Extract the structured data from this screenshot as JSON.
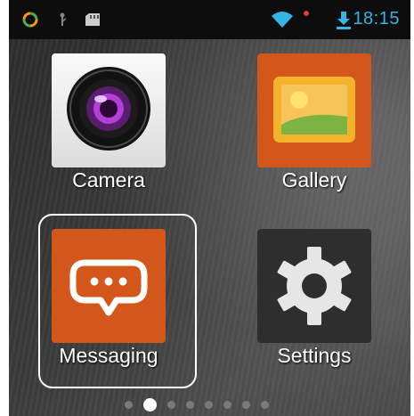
{
  "status_bar": {
    "time": "18:15",
    "icons": [
      "sync-icon",
      "usb-icon",
      "sd-card-icon",
      "wifi-icon",
      "alert-dot-icon",
      "download-icon"
    ],
    "accent_color": "#33b5e5"
  },
  "apps": [
    {
      "id": "camera",
      "label": "Camera",
      "icon": "camera-icon"
    },
    {
      "id": "gallery",
      "label": "Gallery",
      "icon": "gallery-icon"
    },
    {
      "id": "messaging",
      "label": "Messaging",
      "icon": "messaging-icon",
      "highlighted": true
    },
    {
      "id": "settings",
      "label": "Settings",
      "icon": "settings-gear-icon"
    }
  ],
  "pager": {
    "page_count": 8,
    "current_page": 2
  },
  "colors": {
    "orange": "#d3571a",
    "highlight": "#ffffff"
  }
}
